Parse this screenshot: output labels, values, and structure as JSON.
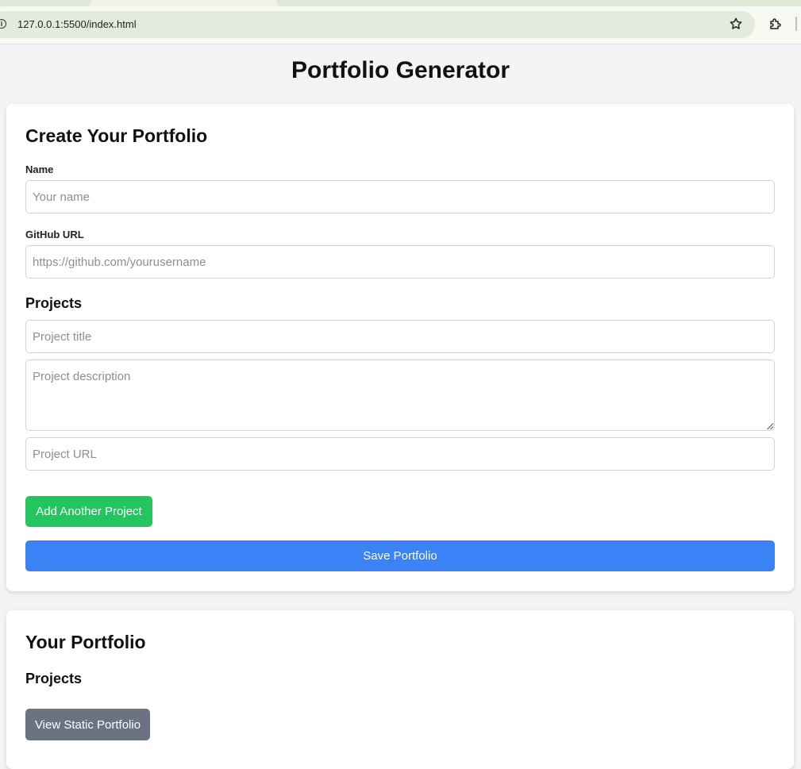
{
  "browser": {
    "url": "127.0.0.1:5500/index.html"
  },
  "page": {
    "title": "Portfolio Generator"
  },
  "form": {
    "heading": "Create Your Portfolio",
    "name_label": "Name",
    "name_placeholder": "Your name",
    "name_value": "",
    "github_label": "GitHub URL",
    "github_placeholder": "https://github.com/yourusername",
    "github_value": "",
    "projects_heading": "Projects",
    "project_title_placeholder": "Project title",
    "project_description_placeholder": "Project description",
    "project_url_placeholder": "Project URL",
    "add_project_label": "Add Another Project",
    "save_label": "Save Portfolio"
  },
  "portfolio": {
    "heading": "Your Portfolio",
    "projects_heading": "Projects",
    "view_static_label": "View Static Portfolio"
  },
  "colors": {
    "add_button": "#22c55e",
    "save_button": "#3b82f6",
    "view_button": "#6b7280"
  }
}
